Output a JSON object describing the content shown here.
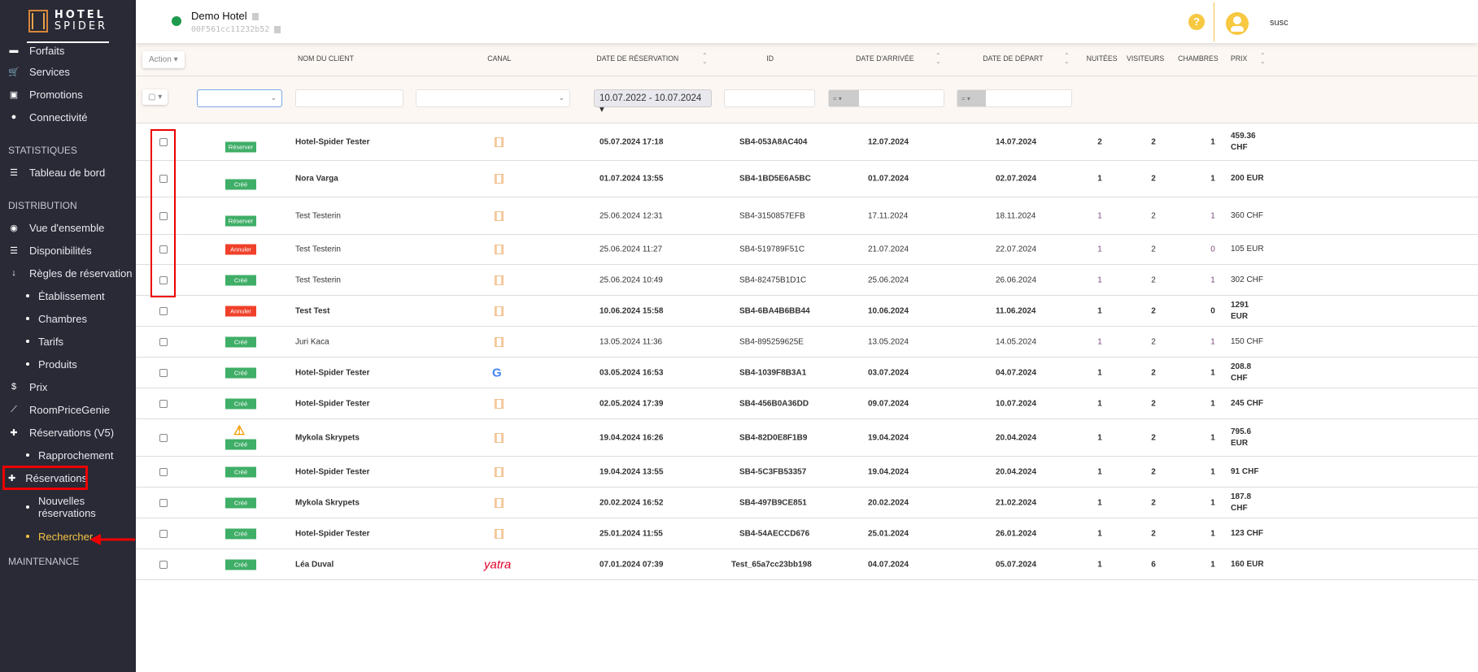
{
  "sidebar": {
    "logo_top": "HOTEL",
    "logo_bottom": "SPIDER",
    "items_top": [
      {
        "label": "Forfaits",
        "icon": "box"
      },
      {
        "label": "Services",
        "icon": "🛒"
      },
      {
        "label": "Promotions",
        "icon": "🎁"
      },
      {
        "label": "Connectivité",
        "icon": "🌐"
      }
    ],
    "section_stats": "STATISTIQUES",
    "dashboard": "Tableau de bord",
    "section_distribution": "DISTRIBUTION",
    "overview": "Vue d'ensemble",
    "availability": "Disponibilités",
    "booking_rules": "Règles de réservation",
    "rules_sub": [
      "Établissement",
      "Chambres",
      "Tarifs",
      "Produits"
    ],
    "prices": "Prix",
    "rpg": "RoomPriceGenie",
    "res_v5": "Réservations (V5)",
    "reconciliation": "Rapprochement",
    "reservations": "Réservations",
    "new_res": "Nouvelles réservations",
    "search": "Rechercher",
    "section_maintenance": "MAINTENANCE"
  },
  "header": {
    "hotel_name": "Demo Hotel",
    "hotel_id": "00F561cc11232b52",
    "help": "?",
    "user": "susc"
  },
  "table": {
    "action_label": "Action",
    "columns": {
      "client": "Nom du client",
      "channel": "Canal",
      "booking_date": "Date de réservation",
      "id": "ID",
      "arrival": "Date d'arrivée",
      "departure": "Date de départ",
      "nights": "Nuitées",
      "visitors": "Visiteurs",
      "rooms": "Chambres",
      "price": "Prix"
    },
    "filters": {
      "date_range": "10.07.2022 - 10.07.2024",
      "eq": "="
    },
    "colors": {
      "green": "#3fae67",
      "red": "#f0402a"
    },
    "rows": [
      {
        "status": "Réserver",
        "color": "green",
        "client": "Hotel-Spider Tester",
        "channel": "hotel-spider",
        "date": "05.07.2024 17:18",
        "id": "SB4-053A8AC404",
        "arr": "12.07.2024",
        "dep": "14.07.2024",
        "n": "2",
        "v": "2",
        "r": "1",
        "price": "459.36 CHF",
        "bold": true
      },
      {
        "status": "Créé",
        "color": "green",
        "client": "Nora Varga",
        "channel": "hotel-spider",
        "date": "01.07.2024 13:55",
        "id": "SB4-1BD5E6A5BC",
        "arr": "01.07.2024",
        "dep": "02.07.2024",
        "n": "1",
        "v": "2",
        "r": "1",
        "price": "200 EUR",
        "bold": true
      },
      {
        "status": "Réserver",
        "color": "green",
        "client": "Test Testerin",
        "channel": "hotel-spider",
        "date": "25.06.2024 12:31",
        "id": "SB4-3150857EFB",
        "arr": "17.11.2024",
        "dep": "18.11.2024",
        "n": "1",
        "v": "2",
        "r": "1",
        "price": "360 CHF",
        "bold": false
      },
      {
        "status": "Annuler",
        "color": "red",
        "client": "Test Testerin",
        "channel": "hotel-spider",
        "date": "25.06.2024 11:27",
        "id": "SB4-519789F51C",
        "arr": "21.07.2024",
        "dep": "22.07.2024",
        "n": "1",
        "v": "2",
        "r": "0",
        "price": "105 EUR",
        "bold": false
      },
      {
        "status": "Créé",
        "color": "green",
        "client": "Test Testerin",
        "channel": "hotel-spider",
        "date": "25.06.2024 10:49",
        "id": "SB4-82475B1D1C",
        "arr": "25.06.2024",
        "dep": "26.06.2024",
        "n": "1",
        "v": "2",
        "r": "1",
        "price": "302 CHF",
        "bold": false
      },
      {
        "status": "Annuler",
        "color": "red",
        "client": "Test Test",
        "channel": "hotel-spider",
        "date": "10.06.2024 15:58",
        "id": "SB4-6BA4B6BB44",
        "arr": "10.06.2024",
        "dep": "11.06.2024",
        "n": "1",
        "v": "2",
        "r": "0",
        "price": "1291 EUR",
        "bold": true
      },
      {
        "status": "Créé",
        "color": "green",
        "client": "Juri Kaca",
        "channel": "hotel-spider",
        "date": "13.05.2024 11:36",
        "id": "SB4-895259625E",
        "arr": "13.05.2024",
        "dep": "14.05.2024",
        "n": "1",
        "v": "2",
        "r": "1",
        "price": "150 CHF",
        "bold": false
      },
      {
        "status": "Créé",
        "color": "green",
        "client": "Hotel-Spider Tester",
        "channel": "google",
        "date": "03.05.2024 16:53",
        "id": "SB4-1039F8B3A1",
        "arr": "03.07.2024",
        "dep": "04.07.2024",
        "n": "1",
        "v": "2",
        "r": "1",
        "price": "208.8 CHF",
        "bold": true
      },
      {
        "status": "Créé",
        "color": "green",
        "client": "Hotel-Spider Tester",
        "channel": "hotel-spider",
        "date": "02.05.2024 17:39",
        "id": "SB4-456B0A36DD",
        "arr": "09.07.2024",
        "dep": "10.07.2024",
        "n": "1",
        "v": "2",
        "r": "1",
        "price": "245 CHF",
        "bold": true
      },
      {
        "status": "Créé",
        "color": "green",
        "warning": true,
        "client": "Mykola Skrypets",
        "channel": "hotel-spider",
        "date": "19.04.2024 16:26",
        "id": "SB4-82D0E8F1B9",
        "arr": "19.04.2024",
        "dep": "20.04.2024",
        "n": "1",
        "v": "2",
        "r": "1",
        "price": "795.6 EUR",
        "bold": true
      },
      {
        "status": "Créé",
        "color": "green",
        "client": "Hotel-Spider Tester",
        "channel": "hotel-spider",
        "date": "19.04.2024 13:55",
        "id": "SB4-5C3FB53357",
        "arr": "19.04.2024",
        "dep": "20.04.2024",
        "n": "1",
        "v": "2",
        "r": "1",
        "price": "91 CHF",
        "bold": true
      },
      {
        "status": "Créé",
        "color": "green",
        "client": "Mykola Skrypets",
        "channel": "hotel-spider",
        "date": "20.02.2024 16:52",
        "id": "SB4-497B9CE851",
        "arr": "20.02.2024",
        "dep": "21.02.2024",
        "n": "1",
        "v": "2",
        "r": "1",
        "price": "187.8 CHF",
        "bold": true
      },
      {
        "status": "Créé",
        "color": "green",
        "client": "Hotel-Spider Tester",
        "channel": "hotel-spider",
        "date": "25.01.2024 11:55",
        "id": "SB4-54AECCD676",
        "arr": "25.01.2024",
        "dep": "26.01.2024",
        "n": "1",
        "v": "2",
        "r": "1",
        "price": "123 CHF",
        "bold": true
      },
      {
        "status": "Créé",
        "color": "green",
        "client": "Léa Duval",
        "channel": "yatra",
        "channel_text": "yatra",
        "date": "07.01.2024 07:39",
        "id": "Test_65a7cc23bb198",
        "arr": "04.07.2024",
        "dep": "05.07.2024",
        "n": "1",
        "v": "6",
        "r": "1",
        "price": "160 EUR",
        "bold": true
      }
    ]
  }
}
